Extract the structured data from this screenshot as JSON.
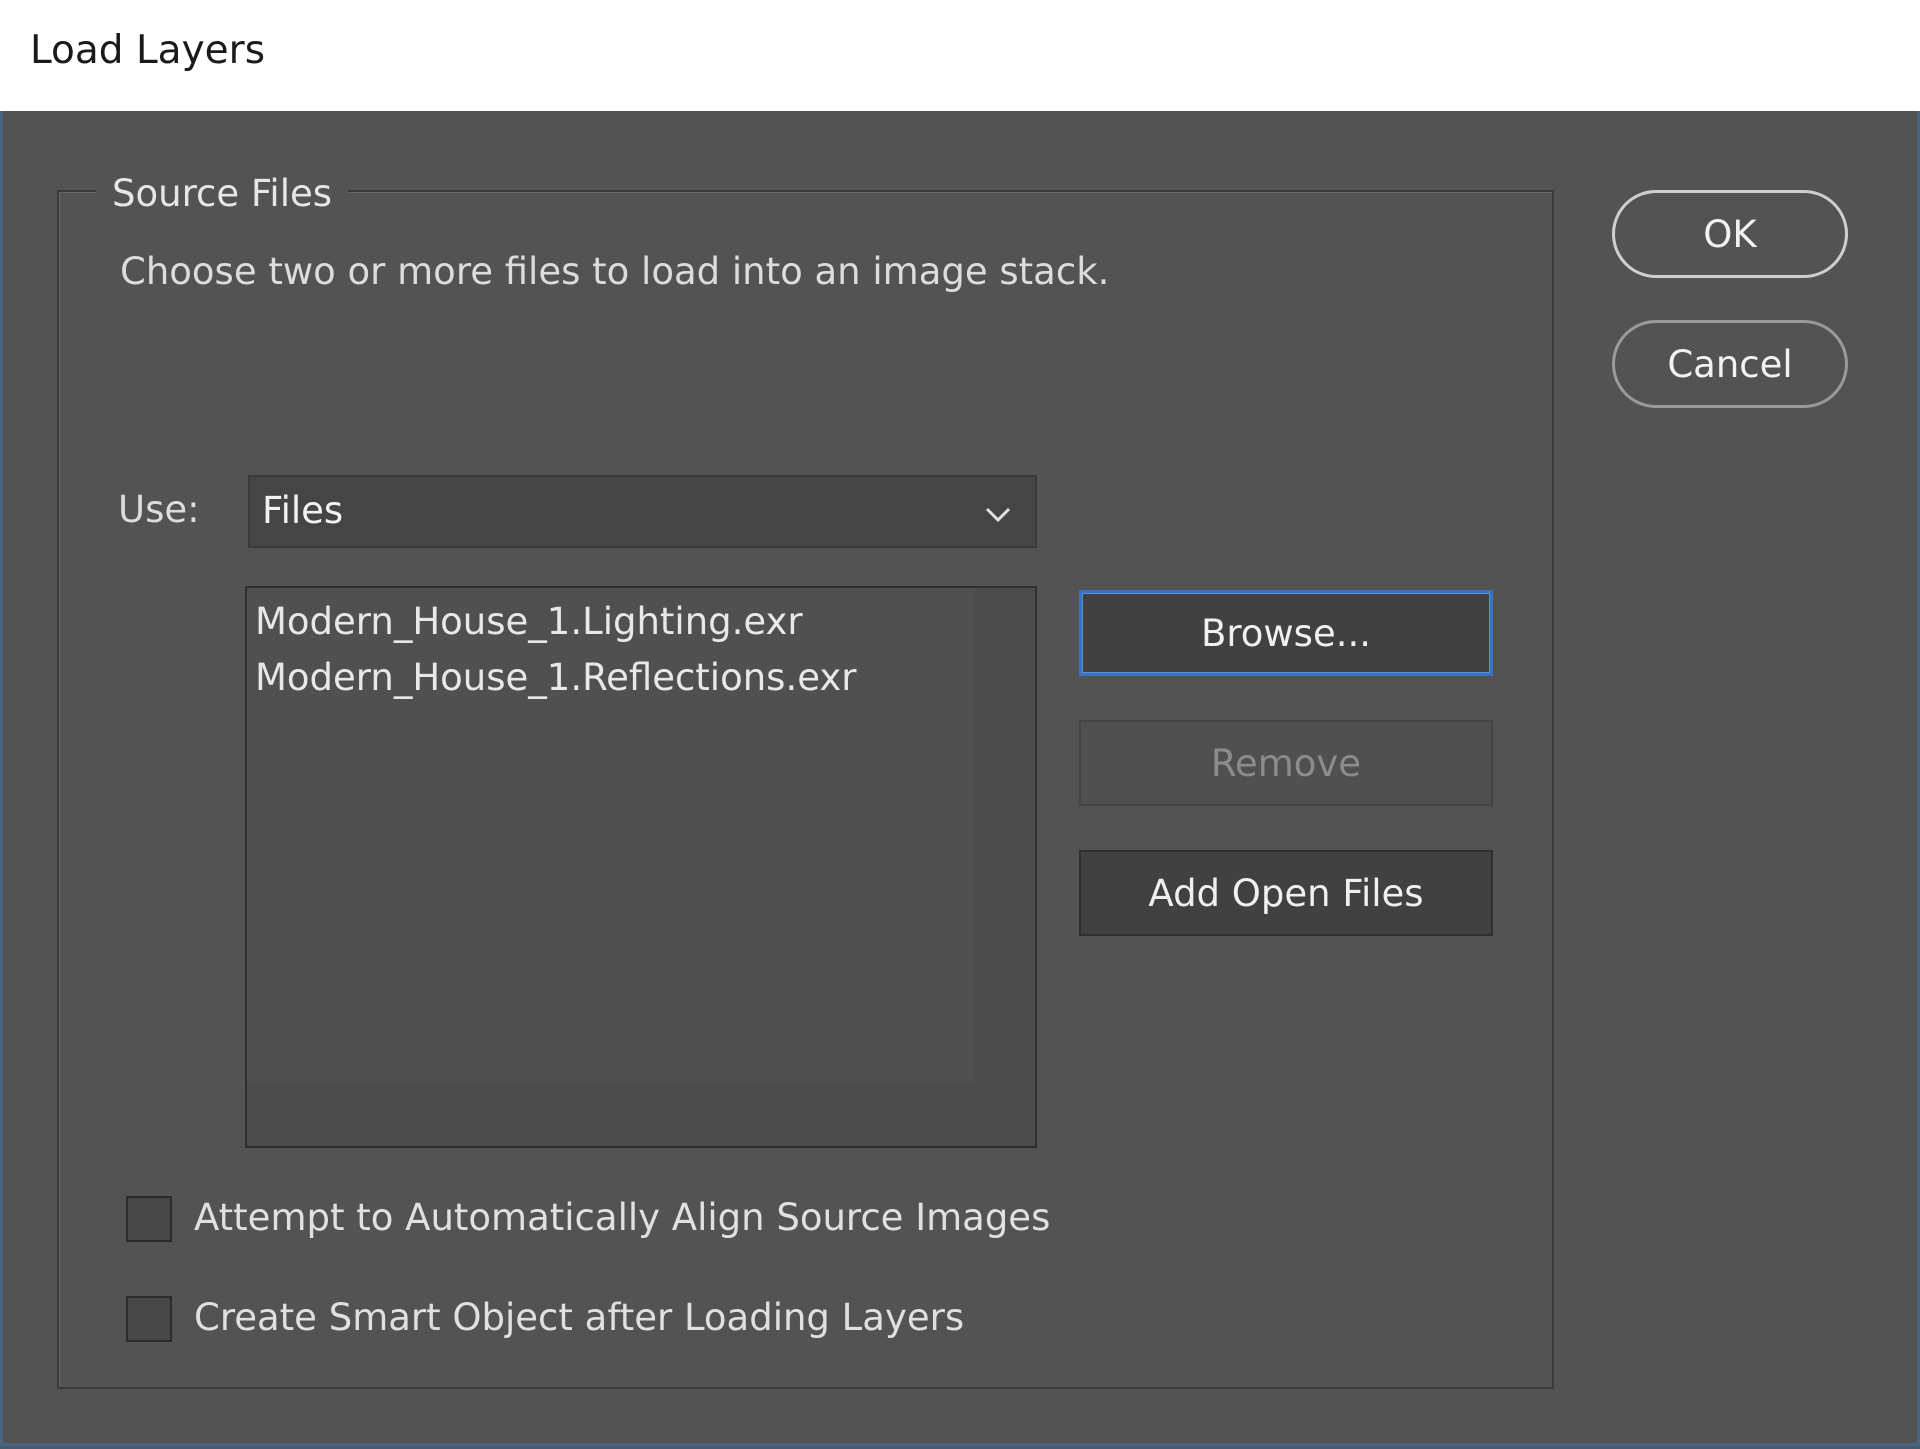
{
  "window": {
    "title": "Load Layers"
  },
  "source_files": {
    "legend": "Source Files",
    "description": "Choose two or more files to load into an image stack.",
    "use_label": "Use:",
    "use_value": "Files",
    "files": [
      "Modern_House_1.Lighting.exr",
      "Modern_House_1.Reflections.exr"
    ],
    "browse_label": "Browse...",
    "remove_label": "Remove",
    "add_open_files_label": "Add Open Files"
  },
  "options": {
    "align_label": "Attempt to Automatically Align Source Images",
    "align_checked": false,
    "smart_object_label": "Create Smart Object after Loading Layers",
    "smart_object_checked": false
  },
  "actions": {
    "ok_label": "OK",
    "cancel_label": "Cancel"
  }
}
